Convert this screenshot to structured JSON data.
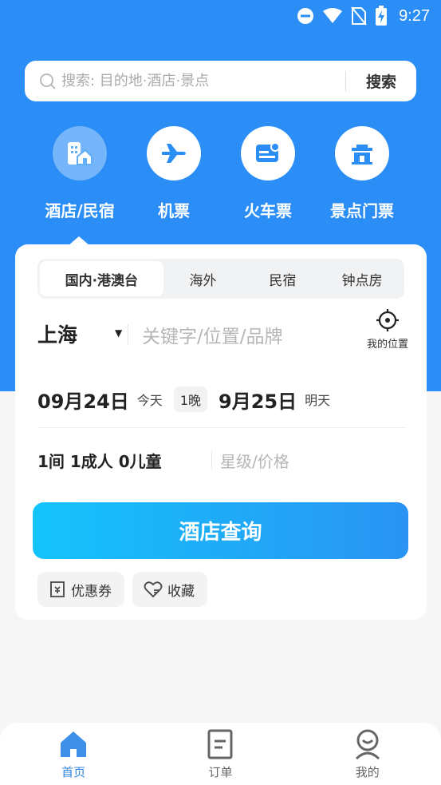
{
  "status_bar": {
    "time": "9:27"
  },
  "search": {
    "placeholder": "搜索: 目的地·酒店·景点",
    "button_label": "搜索"
  },
  "categories": [
    {
      "label": "酒店/民宿",
      "icon": "hotel-icon",
      "active": true
    },
    {
      "label": "机票",
      "icon": "plane-icon"
    },
    {
      "label": "火车票",
      "icon": "train-ticket-icon"
    },
    {
      "label": "景点门票",
      "icon": "attraction-icon"
    }
  ],
  "tabs": [
    "国内·港澳台",
    "海外",
    "民宿",
    "钟点房"
  ],
  "booking": {
    "city": "上海",
    "keyword_placeholder": "关键字/位置/品牌",
    "my_location_label": "我的位置",
    "checkin_date": "09月24日",
    "checkin_sub": "今天",
    "nights": "1晚",
    "checkout_date": "9月25日",
    "checkout_sub": "明天",
    "guests": "1间 1成人 0儿童",
    "star_price_placeholder": "星级/价格",
    "query_button": "酒店查询",
    "chips": [
      {
        "label": "优惠券",
        "icon": "coupon-icon"
      },
      {
        "label": "收藏",
        "icon": "favorite-icon"
      }
    ]
  },
  "bottom_nav": [
    {
      "label": "首页",
      "icon": "home-icon",
      "active": true
    },
    {
      "label": "订单",
      "icon": "order-icon"
    },
    {
      "label": "我的",
      "icon": "profile-icon"
    }
  ],
  "colors": {
    "primary": "#2b8ef6",
    "button_gradient_start": "#14c4fb",
    "button_gradient_end": "#2a93f3"
  }
}
